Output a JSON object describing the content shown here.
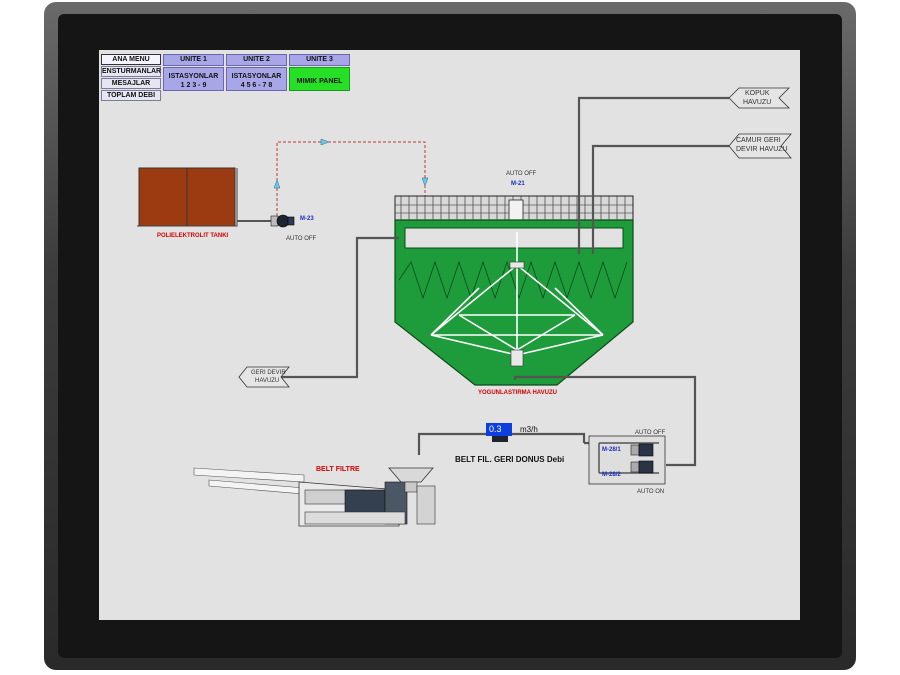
{
  "menu": {
    "items": [
      "ANA MENU",
      "ENSTURMANLAR",
      "MESAJLAR",
      "TOPLAM DEBI"
    ],
    "units": [
      {
        "head": "UNITE 1",
        "line1": "ISTASYONLAR",
        "line2": "1 2 3 - 9"
      },
      {
        "head": "UNITE 2",
        "line1": "ISTASYONLAR",
        "line2": "4 5 6 - 7 8"
      },
      {
        "head": "UNITE 3",
        "line1": "MIMIK PANEL",
        "line2": ""
      }
    ]
  },
  "labels": {
    "polyelectrolyte_tank": "POLIELEKTROLIT TANKI",
    "pump_m23": "M-23",
    "pump_m23_state": "AUTO OFF",
    "mixer_m21": "M-21",
    "mixer_m21_state": "AUTO OFF",
    "thickener": "YOGUNLASTIRMA HAVUZU",
    "foam_pool_1": "KOPUK",
    "foam_pool_2": "HAVUZU",
    "sludge_return_1": "CAMUR GERI",
    "sludge_return_2": "DEVIR HAVUZU",
    "return_pool_1": "GERI DEVIR",
    "return_pool_2": "HAVUZU",
    "belt_filter": "BELT FILTRE",
    "belt_return_flow": "BELT FIL. GERI DONUS Debi",
    "pump_m28_1": "M-28/1",
    "pump_m28_2": "M-28/2",
    "pump_m28_1_state": "AUTO OFF",
    "pump_m28_2_state": "AUTO ON"
  },
  "flow": {
    "value": "0.3",
    "unit": "m3/h"
  },
  "colors": {
    "screen_bg": "#e2e2e2",
    "tank_fill": "#9c3a12",
    "sludge_green": "#1e9b3a",
    "active_green": "#26e026",
    "unit_purple": "#a9a6e8",
    "value_blue": "#0d3fe0",
    "alarm_red": "#d40000",
    "pipe_gray": "#555555"
  }
}
